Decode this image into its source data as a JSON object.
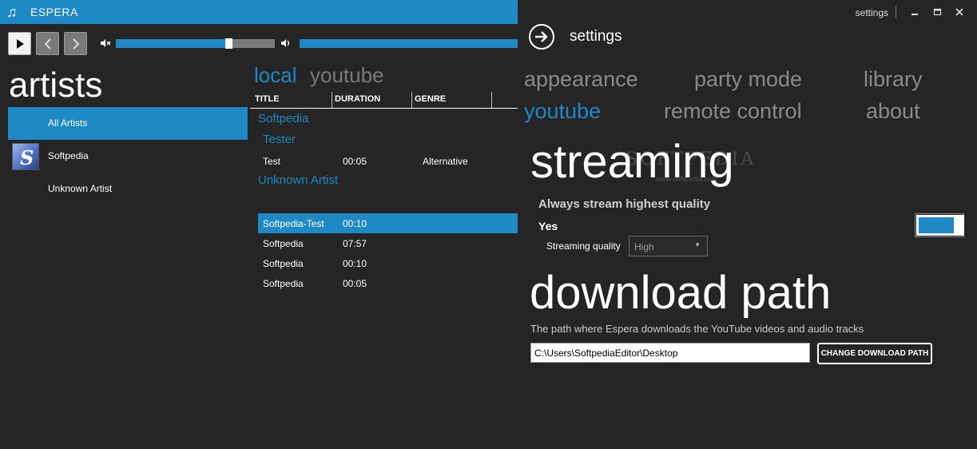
{
  "app": {
    "title": "ESPERA",
    "icon": "music-note-icon"
  },
  "player": {
    "volume": 0.69,
    "icons": [
      "play-icon",
      "previous-icon",
      "next-icon",
      "mute-icon",
      "volume-icon"
    ]
  },
  "library": {
    "title": "artists",
    "artists": [
      {
        "label": "All Artists",
        "selected": true
      },
      {
        "label": "Softpedia",
        "selected": false
      },
      {
        "label": "Unknown Artist",
        "selected": false
      }
    ],
    "avatar_letter": "S",
    "tabs": {
      "local": "local",
      "youtube": "youtube"
    },
    "columns": {
      "title": "TITLE",
      "duration": "DURATION",
      "genre": "GENRE"
    },
    "groups": {
      "artist1": "Softpedia",
      "album1": "Tester",
      "artist2": "Unknown Artist"
    },
    "songs": [
      {
        "title": "Test",
        "duration": "00:05",
        "genre": "Alternative"
      },
      {
        "title": "Softpedia-Test",
        "duration": "00:10",
        "genre": ""
      },
      {
        "title": "Softpedia",
        "duration": "07:57",
        "genre": ""
      },
      {
        "title": "Softpedia",
        "duration": "00:10",
        "genre": ""
      },
      {
        "title": "Softpedia",
        "duration": "00:05",
        "genre": ""
      }
    ]
  },
  "settings": {
    "caption": "settings",
    "title": "settings",
    "categories": {
      "appearance": "appearance",
      "party_mode": "party mode",
      "library": "library",
      "youtube": "youtube",
      "remote_control": "remote control",
      "about": "about"
    },
    "streaming": {
      "heading": "streaming",
      "label": "Always stream highest quality",
      "value": "Yes",
      "quality_label": "Streaming quality",
      "quality_value": "High"
    },
    "download": {
      "heading": "download path",
      "description": "The path where Espera downloads the YouTube videos and audio tracks",
      "path": "C:\\Users\\SoftpediaEditor\\Desktop",
      "button": "CHANGE DOWNLOAD PATH"
    },
    "watermark": "SOFTPEDIA",
    "watermark_url": "www.softpedia.com"
  },
  "colors": {
    "accent": "#1e89c4",
    "background": "#252525",
    "inactive": "#8a8a8a"
  }
}
